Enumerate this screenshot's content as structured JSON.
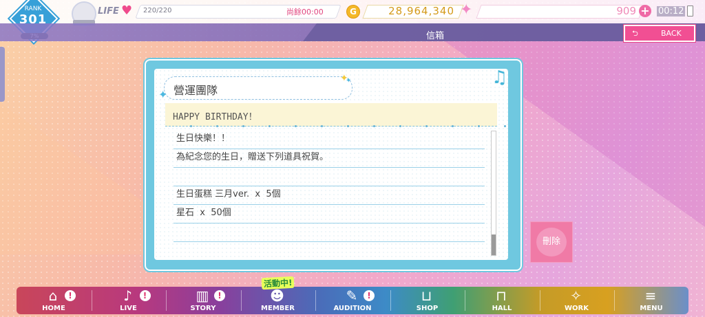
{
  "status": {
    "rank_label": "RANK",
    "rank": "301",
    "rank_progress": "7%",
    "life_label": "LIFE",
    "life_value": "220/220",
    "life_timer": "尚餘00:00",
    "coin_glyph": "G",
    "coins": "28,964,340",
    "gems": "909",
    "clock": "00:12"
  },
  "header": {
    "title": "信箱",
    "back_label": "BACK"
  },
  "mail": {
    "sender": "營運團隊",
    "subject": "HAPPY BIRTHDAY！",
    "lines": [
      "生日快樂！！",
      "為紀念您的生日，贈送下列道具祝賀。",
      "",
      "生日蛋糕 三月ver.  x  5個",
      "星石  x  50個",
      ""
    ],
    "scroll_position": 1.0
  },
  "actions": {
    "delete_label": "刪除"
  },
  "nav": {
    "event_badge": "活動中!",
    "items": [
      {
        "label": "HOME",
        "icon": "home-icon",
        "alert": true
      },
      {
        "label": "LIVE",
        "icon": "music-note-icon",
        "alert": true
      },
      {
        "label": "STORY",
        "icon": "book-icon",
        "alert": true
      },
      {
        "label": "MEMBER",
        "icon": "member-icon",
        "alert": false
      },
      {
        "label": "AUDITION",
        "icon": "audition-icon",
        "alert": true
      },
      {
        "label": "SHOP",
        "icon": "basket-icon",
        "alert": false
      },
      {
        "label": "HALL",
        "icon": "hall-icon",
        "alert": false
      },
      {
        "label": "WORK",
        "icon": "work-icon",
        "alert": false
      },
      {
        "label": "MENU",
        "icon": "menu-icon",
        "alert": false
      }
    ],
    "alert_glyph": "!"
  },
  "colors": {
    "accent_pink": "#f14f93",
    "dialog_blue": "#6fc8e0",
    "coin_gold": "#d49a18"
  }
}
